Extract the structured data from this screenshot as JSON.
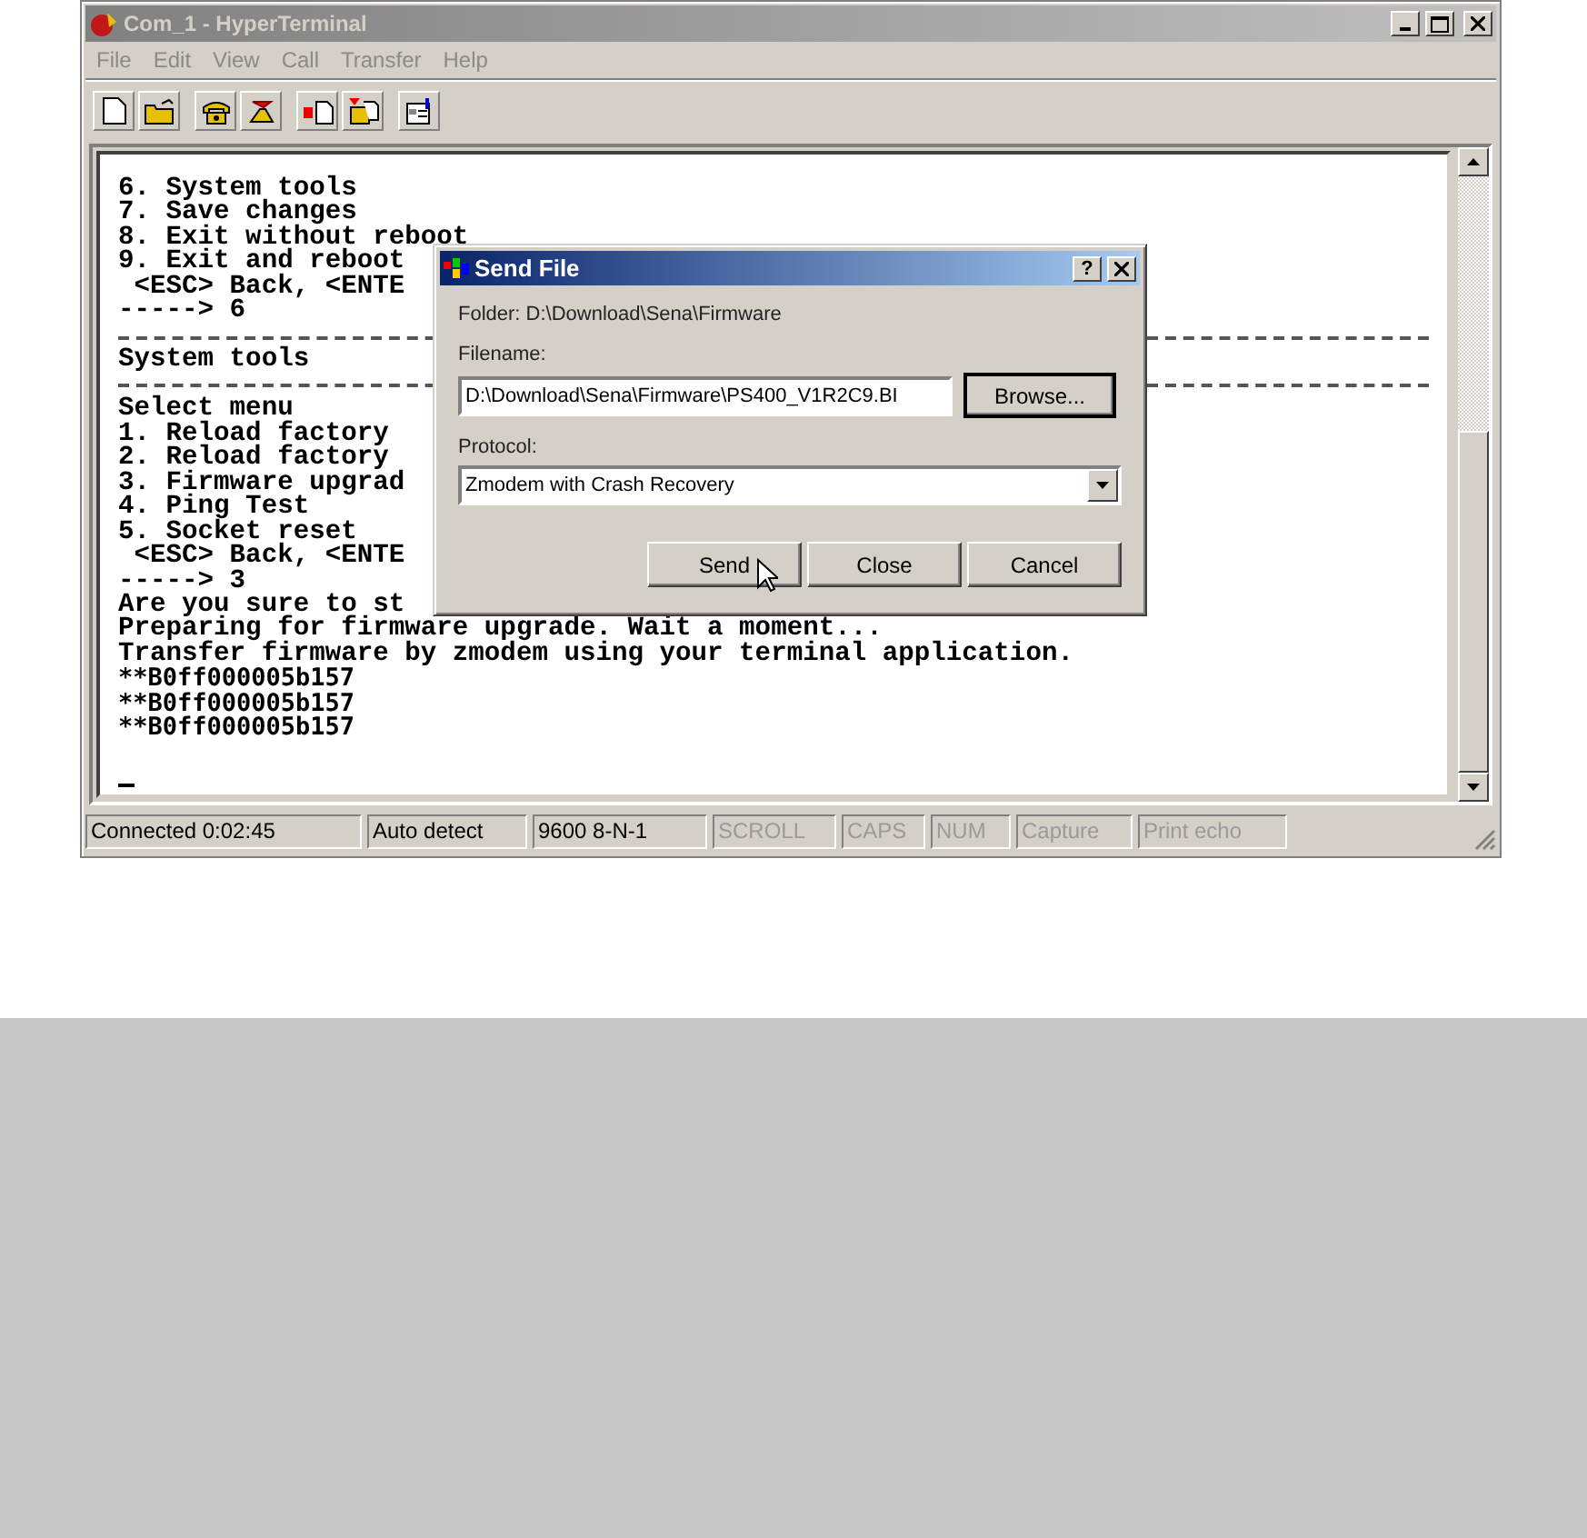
{
  "window": {
    "title": "Com_1 - HyperTerminal"
  },
  "menu": [
    "File",
    "Edit",
    "View",
    "Call",
    "Transfer",
    "Help"
  ],
  "toolbar": [
    {
      "kind": "new"
    },
    {
      "kind": "open"
    },
    {
      "kind": "call"
    },
    {
      "kind": "hangup"
    },
    {
      "kind": "send"
    },
    {
      "kind": "receive"
    },
    {
      "kind": "properties"
    }
  ],
  "terminal": {
    "lines": [
      {
        "kind": "text",
        "text": "6. System tools"
      },
      {
        "kind": "text",
        "text": "7. Save changes"
      },
      {
        "kind": "text",
        "text": "8. Exit without reboot"
      },
      {
        "kind": "text",
        "text": "9. Exit and reboot"
      },
      {
        "kind": "text",
        "text": " <ESC> Back, <ENTE"
      },
      {
        "kind": "text",
        "text": "-----> 6"
      },
      {
        "kind": "rule"
      },
      {
        "kind": "text",
        "text": "System tools"
      },
      {
        "kind": "rule"
      },
      {
        "kind": "text",
        "text": "Select menu"
      },
      {
        "kind": "text",
        "text": "1. Reload factory"
      },
      {
        "kind": "text",
        "text": "2. Reload factory"
      },
      {
        "kind": "text",
        "text": "3. Firmware upgrad"
      },
      {
        "kind": "text",
        "text": "4. Ping Test"
      },
      {
        "kind": "text",
        "text": "5. Socket reset"
      },
      {
        "kind": "text",
        "text": " <ESC> Back, <ENTE"
      },
      {
        "kind": "text",
        "text": "-----> 3"
      },
      {
        "kind": "text",
        "text": "Are you sure to st"
      },
      {
        "kind": "text",
        "text": "Preparing for firmware upgrade. Wait a moment..."
      },
      {
        "kind": "text",
        "text": "Transfer firmware by zmodem using your terminal application."
      },
      {
        "kind": "raw",
        "text": "**B0ff000005b157"
      },
      {
        "kind": "raw",
        "text": "**B0ff000005b157"
      },
      {
        "kind": "raw",
        "text": "**B0ff000005b157"
      },
      {
        "kind": "blank"
      },
      {
        "kind": "cursor"
      }
    ]
  },
  "dialog": {
    "title": "Send File",
    "folder": "Folder:  D:\\Download\\Sena\\Firmware",
    "filename_label": "Filename:",
    "filename": "D:\\Download\\Sena\\Firmware\\PS400_V1R2C9.BI",
    "browse": "Browse...",
    "protocol_label": "Protocol:",
    "protocol": "Zmodem with Crash Recovery",
    "help": "?",
    "buttons": [
      "Send",
      "Close",
      "Cancel"
    ]
  },
  "status_bar": [
    {
      "text": "Connected 0:02:45",
      "disabled": false
    },
    {
      "text": "Auto detect",
      "disabled": false
    },
    {
      "text": "9600 8-N-1",
      "disabled": false
    },
    {
      "text": "SCROLL",
      "disabled": true
    },
    {
      "text": "CAPS",
      "disabled": true
    },
    {
      "text": "NUM",
      "disabled": true
    },
    {
      "text": "Capture",
      "disabled": true
    },
    {
      "text": "Print echo",
      "disabled": true
    }
  ]
}
